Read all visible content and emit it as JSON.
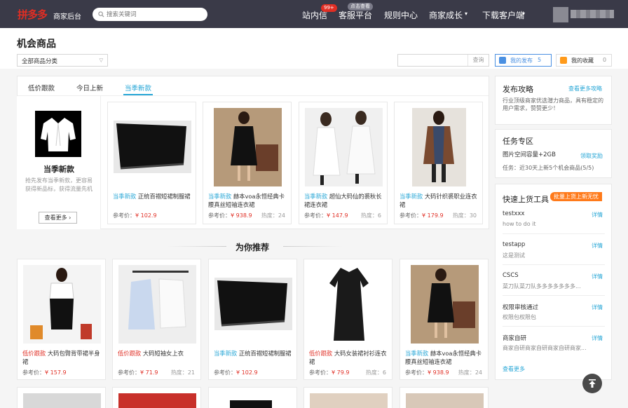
{
  "header": {
    "logo": "拼多多",
    "logo_sub": "商家后台",
    "search_placeholder": "搜索关键词",
    "nav": [
      {
        "label": "站内信",
        "badge": "99+"
      },
      {
        "label": "客服平台",
        "badge": "点击查看"
      },
      {
        "label": "规则中心"
      },
      {
        "label": "商家成长"
      },
      {
        "label": "下载客户端"
      }
    ]
  },
  "page": {
    "title": "机会商品",
    "category_select": "全部商品分类",
    "query_button": "查询",
    "my_publish": {
      "label": "我的发布",
      "count": "5"
    },
    "my_favorite": {
      "label": "我的收藏",
      "count": "0"
    }
  },
  "tabs": [
    "低价跟款",
    "今日上新",
    "当季新款"
  ],
  "promo": {
    "title": "当季新款",
    "desc": "抢先发布当季新款，更容易获得新品标，获得流量先机",
    "button": "查看更多"
  },
  "labels": {
    "price_prefix": "参考价：",
    "heat_prefix": "热度："
  },
  "season_products": [
    {
      "tag": "当季新款",
      "title": "正统百褶短裙制服裙",
      "price": "¥ 102.9",
      "heat": ""
    },
    {
      "tag": "当季新款",
      "title": "赫本voa永恒经典卡腰真丝短袖连衣裙",
      "price": "¥ 938.9",
      "heat": "24"
    },
    {
      "tag": "当季新款",
      "title": "超仙大码仙的裘秋长裙连衣裙",
      "price": "¥ 147.9",
      "heat": "6"
    },
    {
      "tag": "当季新款",
      "title": "大码针织裘职业连衣裙",
      "price": "¥ 179.9",
      "heat": "30"
    }
  ],
  "recommend": {
    "title": "为你推荐",
    "products": [
      {
        "tag": "低价跟款",
        "tag_type": "low",
        "title": "大码包臀背带裙半身裙",
        "price": "¥ 157.9",
        "heat": ""
      },
      {
        "tag": "低价跟款",
        "tag_type": "low",
        "title": "大码短袖女上衣",
        "price": "¥ 71.9",
        "heat": "21"
      },
      {
        "tag": "当季新款",
        "tag_type": "new",
        "title": "正统百褶短裙制服裙",
        "price": "¥ 102.9",
        "heat": ""
      },
      {
        "tag": "低价跟款",
        "tag_type": "low",
        "title": "大码女装裙衬衫连衣裙",
        "price": "¥ 79.9",
        "heat": "6"
      },
      {
        "tag": "当季新款",
        "tag_type": "new",
        "title": "赫本voa永恒经典卡腰真丝短袖连衣裙",
        "price": "¥ 938.9",
        "heat": "24"
      }
    ]
  },
  "sidebar": {
    "guide": {
      "title": "发布攻略",
      "link": "查看更多攻略",
      "text": "行业顶级商家优选潜力商品，具有稳定的用户需求，赞赞更少！"
    },
    "tasks": {
      "title": "任务专区",
      "item": "图片空间容量+2GB",
      "link": "领取奖励",
      "detail": "任务：近30天上新5个机会商品(5/5)"
    },
    "tools": {
      "title": "快速上货工具",
      "badge": "批量上货上新无忧",
      "link_label": "详情",
      "items": [
        {
          "name": "testxxx",
          "desc": "how to do it"
        },
        {
          "name": "testapp",
          "desc": "这是测试"
        },
        {
          "name": "CSCS",
          "desc": "菜刀队菜刀队多多多多多多多..."
        },
        {
          "name": "权限审核通过",
          "desc": "权限包权限包"
        },
        {
          "name": "商家自研",
          "desc": "商家自研商家自研商家自研商家..."
        }
      ],
      "more": "查看更多"
    }
  }
}
